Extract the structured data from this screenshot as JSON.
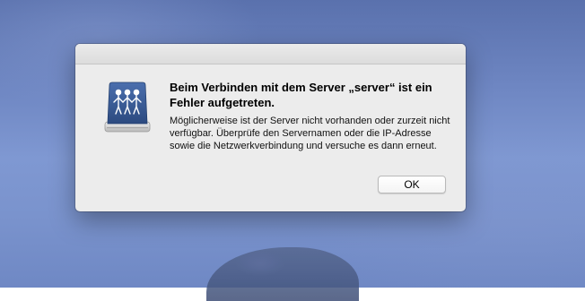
{
  "dialog": {
    "title": "Beim Verbinden mit dem Server „server“ ist ein Fehler aufgetreten.",
    "message": "Möglicherweise ist der Server nicht vorhanden oder zurzeit nicht verfügbar. Überprüfe den Servernamen oder die IP-Adresse sowie die Netzwerkverbindung und versuche es dann erneut.",
    "ok_label": "OK",
    "icon": "shared-server-icon"
  },
  "colors": {
    "dialog_background": "#ececec",
    "desktop_blue": "#6e86c2",
    "icon_blue": "#3a5c9a"
  }
}
